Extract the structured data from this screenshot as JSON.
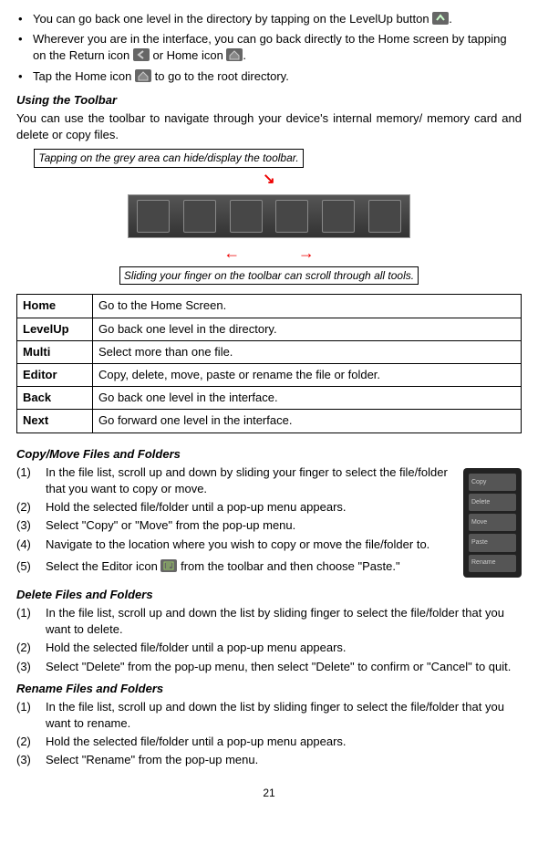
{
  "bullets": [
    {
      "pre": "You can go back one level in the directory by tapping on the LevelUp button ",
      "post": "."
    },
    {
      "pre": "Wherever you are in the interface, you can go back directly to the Home screen by tapping on the Return icon ",
      "mid": " or Home icon ",
      "post": "."
    },
    {
      "pre": "Tap the Home icon ",
      "post": " to go to the root directory."
    }
  ],
  "section1": {
    "heading": "Using the Toolbar",
    "para": "You can use the toolbar to navigate through your device's internal memory/ memory card and delete or copy files.",
    "callout_top": "Tapping on the grey area can hide/display the toolbar.",
    "callout_bottom": "Sliding your finger on the toolbar can scroll through all tools."
  },
  "table": [
    {
      "name": "Home",
      "desc": "Go to the Home Screen."
    },
    {
      "name": "LevelUp",
      "desc": "Go back one level in the directory."
    },
    {
      "name": "Multi",
      "desc": "Select more than one file."
    },
    {
      "name": "Editor",
      "desc": "Copy, delete, move, paste or rename the file or folder."
    },
    {
      "name": "Back",
      "desc": "Go back one level in the interface."
    },
    {
      "name": "Next",
      "desc": "Go forward one level in the interface."
    }
  ],
  "copyMove": {
    "heading": "Copy/Move Files and Folders",
    "steps": [
      "In the file list, scroll up and down by sliding your finger to select the file/folder that you want to copy or move.",
      "Hold the selected file/folder until a pop-up menu appears.",
      "Select \"Copy\" or \"Move\" from the pop-up menu.",
      "Navigate to the location where you wish to copy or move the file/folder to."
    ],
    "step5_pre": "Select the Editor icon ",
    "step5_post": " from the toolbar and then choose \"Paste.\"",
    "popup_items": [
      "Copy",
      "Delete",
      "Move",
      "Paste",
      "Rename"
    ]
  },
  "delete": {
    "heading": "Delete Files and Folders",
    "steps": [
      "In the file list, scroll up and down the list by sliding finger to select the file/folder that you want to delete.",
      "Hold the selected file/folder until a pop-up menu appears.",
      "Select \"Delete\" from the pop-up menu, then select \"Delete\" to confirm or \"Cancel\" to quit."
    ]
  },
  "rename": {
    "heading": "Rename Files and Folders",
    "steps": [
      "In the file list, scroll up and down the list by sliding finger to select the file/folder that you want to rename.",
      "Hold the selected file/folder until a pop-up menu appears.",
      "Select \"Rename\" from the pop-up menu."
    ]
  },
  "pageNumber": "21"
}
